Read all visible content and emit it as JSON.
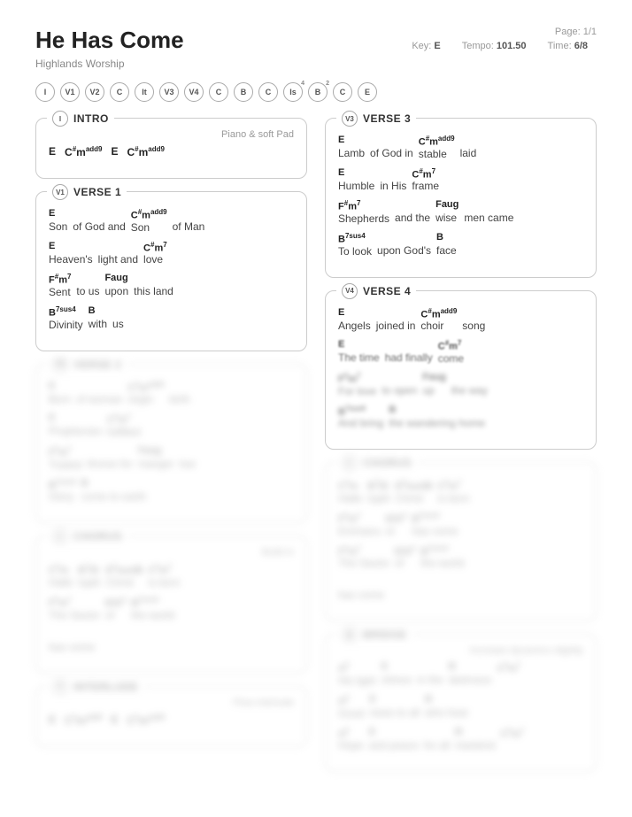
{
  "header": {
    "title": "He Has Come",
    "artist": "Highlands Worship",
    "page_label": "Page:",
    "page_value": "1/1",
    "key_label": "Key:",
    "key_value": "E",
    "tempo_label": "Tempo:",
    "tempo_value": "101.50",
    "time_label": "Time:",
    "time_value": "6/8"
  },
  "nav": [
    {
      "label": "I"
    },
    {
      "label": "V1"
    },
    {
      "label": "V2"
    },
    {
      "label": "C"
    },
    {
      "label": "It"
    },
    {
      "label": "V3"
    },
    {
      "label": "V4"
    },
    {
      "label": "C"
    },
    {
      "label": "B"
    },
    {
      "label": "C"
    },
    {
      "label": "Is",
      "sup": "4"
    },
    {
      "label": "B",
      "sup": "2"
    },
    {
      "label": "C"
    },
    {
      "label": "E"
    }
  ],
  "left": [
    {
      "badge": "I",
      "name": "INTRO",
      "note": "Piano & soft Pad",
      "blurred": false,
      "lines": [
        {
          "chordsOnly": true,
          "cells": [
            {
              "chord": "E"
            },
            {
              "chord": "C<sup>#</sup>m<sup>add9</sup>"
            },
            {
              "chord": "E"
            },
            {
              "chord": "C<sup>#</sup>m<sup>add9</sup>"
            }
          ]
        }
      ]
    },
    {
      "badge": "V1",
      "name": "VERSE 1",
      "blurred": false,
      "lines": [
        {
          "cells": [
            {
              "chord": "E",
              "lyric": "Son"
            },
            {
              "lyric": "of God and"
            },
            {
              "chord": "C<sup>#</sup>m<sup>add9</sup>",
              "lyric": "Son"
            },
            {
              "lyric": "of Man"
            }
          ]
        },
        {
          "cells": [
            {
              "chord": "E",
              "lyric": "Heaven's"
            },
            {
              "lyric": "light and"
            },
            {
              "chord": "C<sup>#</sup>m<sup>7</sup>",
              "lyric": "love"
            }
          ]
        },
        {
          "cells": [
            {
              "chord": "F<sup>#</sup>m<sup>7</sup>",
              "lyric": "Sent"
            },
            {
              "lyric": "to us"
            },
            {
              "chord": "Faug",
              "lyric": "upon"
            },
            {
              "lyric": "this land"
            }
          ]
        },
        {
          "cells": [
            {
              "chord": "B<sup>7sus4</sup>",
              "lyric": "Divinity"
            },
            {
              "chord": "B",
              "lyric": "with"
            },
            {
              "lyric": "us"
            }
          ]
        }
      ]
    },
    {
      "badge": "V2",
      "name": "VERSE 2",
      "blurred": true,
      "lines": [
        {
          "cells": [
            {
              "chord": "E",
              "lyric": "Born"
            },
            {
              "lyric": "of woman"
            },
            {
              "chord": "C<sup>#</sup>m<sup>add9</sup>",
              "lyric": "virgin"
            },
            {
              "lyric": "birth"
            }
          ]
        },
        {
          "cells": [
            {
              "chord": "E",
              "lyric": "Prophecies"
            },
            {
              "chord": "C<sup>#</sup>m<sup>7</sup>",
              "lyric": "fulfilled"
            }
          ]
        },
        {
          "cells": [
            {
              "chord": "F<sup>#</sup>m<sup>7</sup>",
              "lyric": "Traded"
            },
            {
              "lyric": "throne for"
            },
            {
              "chord": "Faug",
              "lyric": "manger"
            },
            {
              "lyric": "low"
            }
          ]
        },
        {
          "cells": [
            {
              "chord": "B<sup>7sus4</sup>",
              "lyric": "Glory"
            },
            {
              "chord": "B",
              "lyric": "come to earth"
            }
          ]
        }
      ]
    },
    {
      "badge": "C",
      "name": "CHORUS",
      "note": "Build in",
      "blurred": true,
      "lines": [
        {
          "cells": [
            {
              "chord": "C<sup>#</sup>m",
              "lyric": "Halle"
            },
            {
              "chord": "B<sup>7</sup>/D",
              "lyric": "lujah"
            },
            {
              "chord": "E<sup>2</sup>sus/B",
              "lyric": "Christ"
            },
            {
              "chord": "C<sup>#</sup>m<sup>7</sup>",
              "lyric": "is born"
            }
          ]
        },
        {
          "cells": [
            {
              "chord": "F<sup>#</sup>m<sup>7</sup>",
              "lyric": "The Savior"
            },
            {
              "chord": "E/G<sup>#</sup>",
              "lyric": "of"
            },
            {
              "chord": "B<sup>7sus4</sup>",
              "lyric": "the world"
            }
          ]
        },
        {
          "cells": [
            {
              "lyric": "has come"
            }
          ]
        }
      ]
    },
    {
      "badge": "It",
      "name": "INTERLUDE",
      "note": "Flow interlude",
      "blurred": true,
      "lines": [
        {
          "chordsOnly": true,
          "cells": [
            {
              "chord": "E"
            },
            {
              "chord": "C<sup>#</sup>m<sup>add9</sup>"
            },
            {
              "chord": "E"
            },
            {
              "chord": "C<sup>#</sup>m<sup>add9</sup>"
            }
          ]
        }
      ]
    }
  ],
  "right": [
    {
      "badge": "V3",
      "name": "VERSE 3",
      "blurred": false,
      "lines": [
        {
          "cells": [
            {
              "chord": "E",
              "lyric": "Lamb"
            },
            {
              "lyric": "of God in"
            },
            {
              "chord": "C<sup>#</sup>m<sup>add9</sup>",
              "lyric": "stable"
            },
            {
              "lyric": "laid"
            }
          ]
        },
        {
          "cells": [
            {
              "chord": "E",
              "lyric": "Humble"
            },
            {
              "lyric": "in His"
            },
            {
              "chord": "C<sup>#</sup>m<sup>7</sup>",
              "lyric": "frame"
            }
          ]
        },
        {
          "cells": [
            {
              "chord": "F<sup>#</sup>m<sup>7</sup>",
              "lyric": "Shepherds"
            },
            {
              "lyric": "and the"
            },
            {
              "chord": "Faug",
              "lyric": "wise"
            },
            {
              "lyric": "men came"
            }
          ]
        },
        {
          "cells": [
            {
              "chord": "B<sup>7sus4</sup>",
              "lyric": "To look"
            },
            {
              "lyric": "upon God's"
            },
            {
              "chord": "B",
              "lyric": "face"
            }
          ]
        }
      ]
    },
    {
      "badge": "V4",
      "name": "VERSE 4",
      "blurred": false,
      "fade": true,
      "lines": [
        {
          "cells": [
            {
              "chord": "E",
              "lyric": "Angels"
            },
            {
              "lyric": "joined in"
            },
            {
              "chord": "C<sup>#</sup>m<sup>add9</sup>",
              "lyric": "choir"
            },
            {
              "lyric": "song"
            }
          ]
        },
        {
          "cells": [
            {
              "chord": "E",
              "lyric": "The time"
            },
            {
              "lyric": "had finally"
            },
            {
              "chord": "C<sup>#</sup>m<sup>7</sup>",
              "lyric": "come"
            }
          ]
        },
        {
          "cells": [
            {
              "chord": "F<sup>#</sup>m<sup>7</sup>",
              "lyric": "For love"
            },
            {
              "lyric": "to open"
            },
            {
              "chord": "Faug",
              "lyric": "up"
            },
            {
              "lyric": "the way"
            }
          ]
        },
        {
          "cells": [
            {
              "chord": "B<sup>7sus4</sup>",
              "lyric": "And bring"
            },
            {
              "chord": "B",
              "lyric": "the wandering home"
            }
          ]
        }
      ]
    },
    {
      "badge": "C",
      "name": "CHORUS",
      "blurred": true,
      "lines": [
        {
          "cells": [
            {
              "chord": "C<sup>#</sup>m",
              "lyric": "Halle"
            },
            {
              "chord": "B<sup>7</sup>/D",
              "lyric": "lujah"
            },
            {
              "chord": "E<sup>2</sup>sus/B",
              "lyric": "Christ"
            },
            {
              "chord": "C<sup>#</sup>m<sup>7</sup>",
              "lyric": "is born"
            }
          ]
        },
        {
          "cells": [
            {
              "chord": "F<sup>#</sup>m<sup>7</sup>",
              "lyric": "Emmanu"
            },
            {
              "chord": "E/G<sup>#</sup>",
              "lyric": "el"
            },
            {
              "chord": "B<sup>7sus4</sup>",
              "lyric": "has come"
            }
          ]
        },
        {
          "cells": [
            {
              "chord": "F<sup>#</sup>m<sup>7</sup>",
              "lyric": "The Savior"
            },
            {
              "chord": "E/G<sup>#</sup>",
              "lyric": "of"
            },
            {
              "chord": "B<sup>7sus4</sup>",
              "lyric": "the world"
            }
          ]
        },
        {
          "cells": [
            {
              "lyric": "has come"
            }
          ]
        }
      ]
    },
    {
      "badge": "B",
      "name": "BRIDGE",
      "note": "Increase dynamics slightly",
      "blurred": true,
      "lines": [
        {
          "cells": [
            {
              "chord": "A<sup>2</sup>",
              "lyric": "His light"
            },
            {
              "chord": "E",
              "lyric": "shines"
            },
            {
              "lyric": "in the"
            },
            {
              "chord": "B",
              "lyric": "darkness"
            },
            {
              "chord": "C<sup>#</sup>m<sup>7</sup>"
            }
          ]
        },
        {
          "cells": [
            {
              "chord": "A<sup>2</sup>",
              "lyric": "Good"
            },
            {
              "chord": "E",
              "lyric": "news to all"
            },
            {
              "chord": "B",
              "lyric": "who hear"
            }
          ]
        },
        {
          "cells": [
            {
              "chord": "A<sup>2</sup>",
              "lyric": "Hope"
            },
            {
              "chord": "E",
              "lyric": "and peace"
            },
            {
              "lyric": "for all"
            },
            {
              "chord": "B",
              "lyric": "mankind"
            },
            {
              "chord": "C<sup>#</sup>m<sup>7</sup>"
            }
          ]
        }
      ]
    }
  ]
}
